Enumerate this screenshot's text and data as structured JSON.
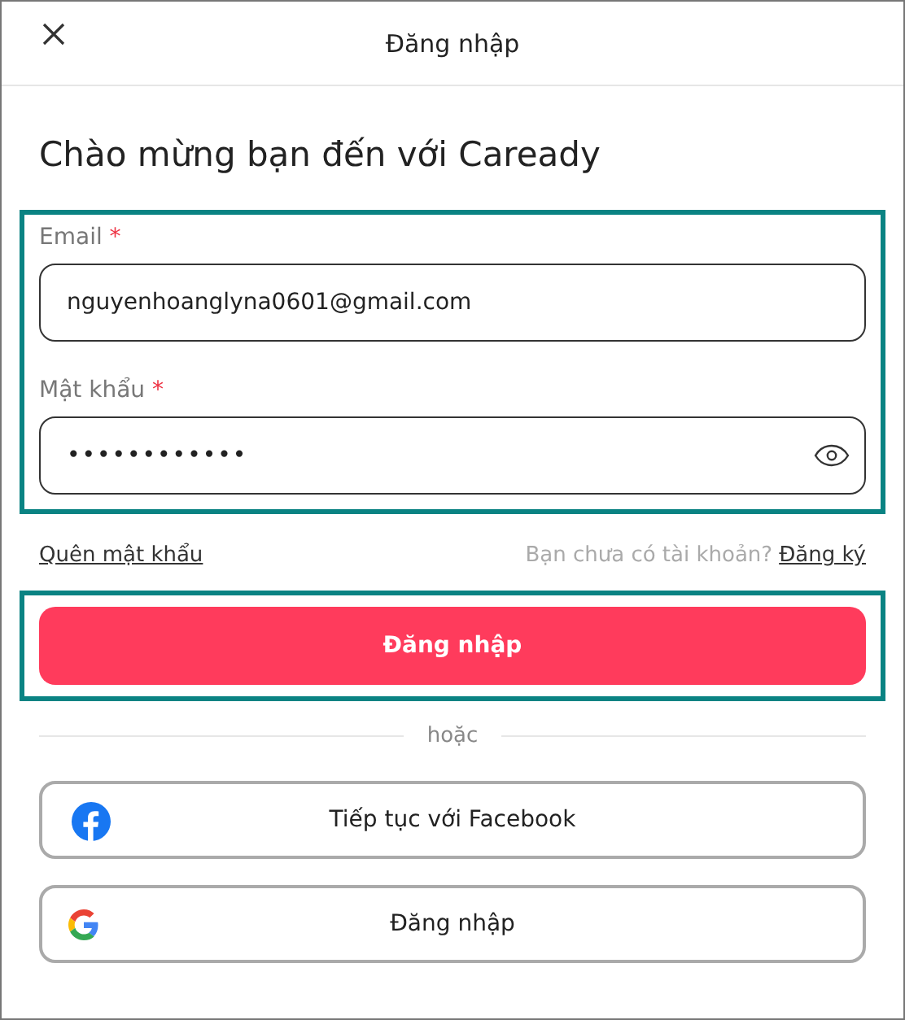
{
  "header": {
    "title": "Đăng nhập"
  },
  "heading": "Chào mừng bạn đến với Caready",
  "fields": [
    {
      "label": "Email",
      "required_mark": "*",
      "value": "nguyenhoanglyna0601@gmail.com",
      "kind": "text"
    },
    {
      "label": "Mật khẩu",
      "required_mark": "*",
      "value": "••••••••••••",
      "kind": "password"
    }
  ],
  "forgot_link": "Quên mật khẩu",
  "signup_prompt": "Bạn chưa có tài khoản?",
  "signup_link": "Đăng ký",
  "submit_button": "Đăng nhập",
  "divider_text": "hoặc",
  "social_buttons": [
    {
      "kind": "facebook",
      "label": "Tiếp tục với Facebook"
    },
    {
      "kind": "google",
      "label": "Đăng nhập"
    }
  ]
}
